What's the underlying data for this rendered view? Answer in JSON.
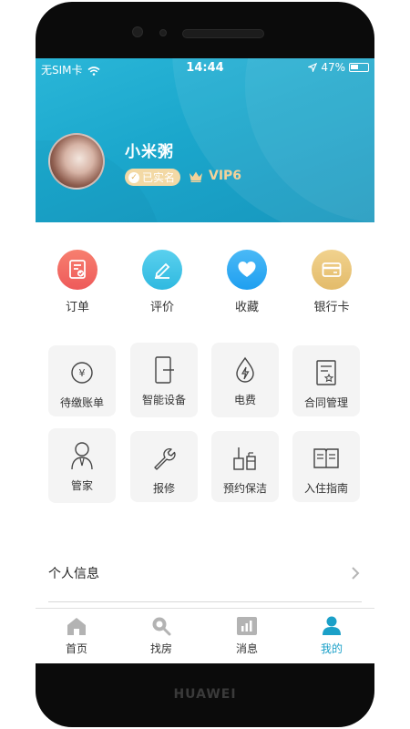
{
  "status_bar": {
    "carrier": "无SIM卡",
    "time": "14:44",
    "battery": "47%",
    "battery_level": 0.47
  },
  "profile": {
    "name": "小米粥",
    "verified_label": "已实名",
    "vip_label": "VIP6"
  },
  "quick_actions": [
    {
      "label": "订单",
      "icon": "order-icon",
      "color": "#f0605f"
    },
    {
      "label": "评价",
      "icon": "edit-icon",
      "color": "#3cc2e6"
    },
    {
      "label": "收藏",
      "icon": "heart-icon",
      "color": "#2aa7ef"
    },
    {
      "label": "银行卡",
      "icon": "bank-card-icon",
      "color": "#e8c378"
    }
  ],
  "services": [
    {
      "label": "待缴账单",
      "icon": "yen-icon"
    },
    {
      "label": "智能设备",
      "icon": "smart-device-icon"
    },
    {
      "label": "电费",
      "icon": "electricity-icon"
    },
    {
      "label": "合同管理",
      "icon": "contract-icon"
    },
    {
      "label": "管家",
      "icon": "butler-icon"
    },
    {
      "label": "报修",
      "icon": "wrench-icon"
    },
    {
      "label": "预约保洁",
      "icon": "cleaning-icon"
    },
    {
      "label": "入住指南",
      "icon": "guide-book-icon"
    }
  ],
  "list": {
    "personal_info": "个人信息"
  },
  "tabs": [
    {
      "label": "首页",
      "icon": "home-icon",
      "active": false
    },
    {
      "label": "找房",
      "icon": "search-icon",
      "active": false
    },
    {
      "label": "消息",
      "icon": "message-icon",
      "active": false
    },
    {
      "label": "我的",
      "icon": "user-icon",
      "active": true
    }
  ],
  "colors": {
    "header": "#1ba7cc",
    "active_tab": "#1ba0c8",
    "gold": "#f3d29a"
  },
  "device_brand": "HUAWEI"
}
